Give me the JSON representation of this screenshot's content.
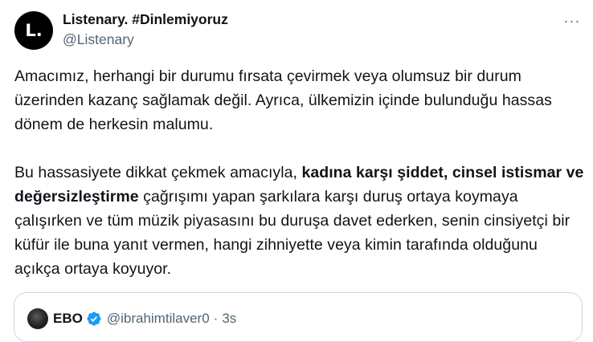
{
  "author": {
    "avatar_letter": "L.",
    "display_name": "Listenary. #Dinlemiyoruz",
    "handle": "@Listenary"
  },
  "more_icon": "···",
  "tweet": {
    "p1": "Amacımız, herhangi bir durumu fırsata çevirmek veya olumsuz bir durum üzerinden kazanç sağlamak değil. Ayrıca, ülkemizin içinde bulunduğu hassas dönem de herkesin malumu.",
    "p2_start": "Bu hassasiyete dikkat çekmek amacıyla, ",
    "p2_bold": "kadına karşı şiddet, cinsel istismar ve değersizleştirme",
    "p2_end": " çağrışımı yapan şarkılara karşı duruş ortaya koymaya çalışırken ve tüm müzik piyasasını bu duruşa davet ederken, senin cinsiyetçi bir küfür ile buna yanıt vermen, hangi zihniyette veya kimin tarafında olduğunu açıkça ortaya koyuyor."
  },
  "quoted": {
    "display_name": "EBO",
    "handle": "@ibrahimtilaver0",
    "separator": "·",
    "time": "3s"
  },
  "colors": {
    "accent": "#1d9bf0",
    "text": "#0f1419",
    "secondary": "#536471",
    "border": "#cfd9de"
  },
  "icons": [
    "more-icon",
    "verified-badge-icon"
  ]
}
